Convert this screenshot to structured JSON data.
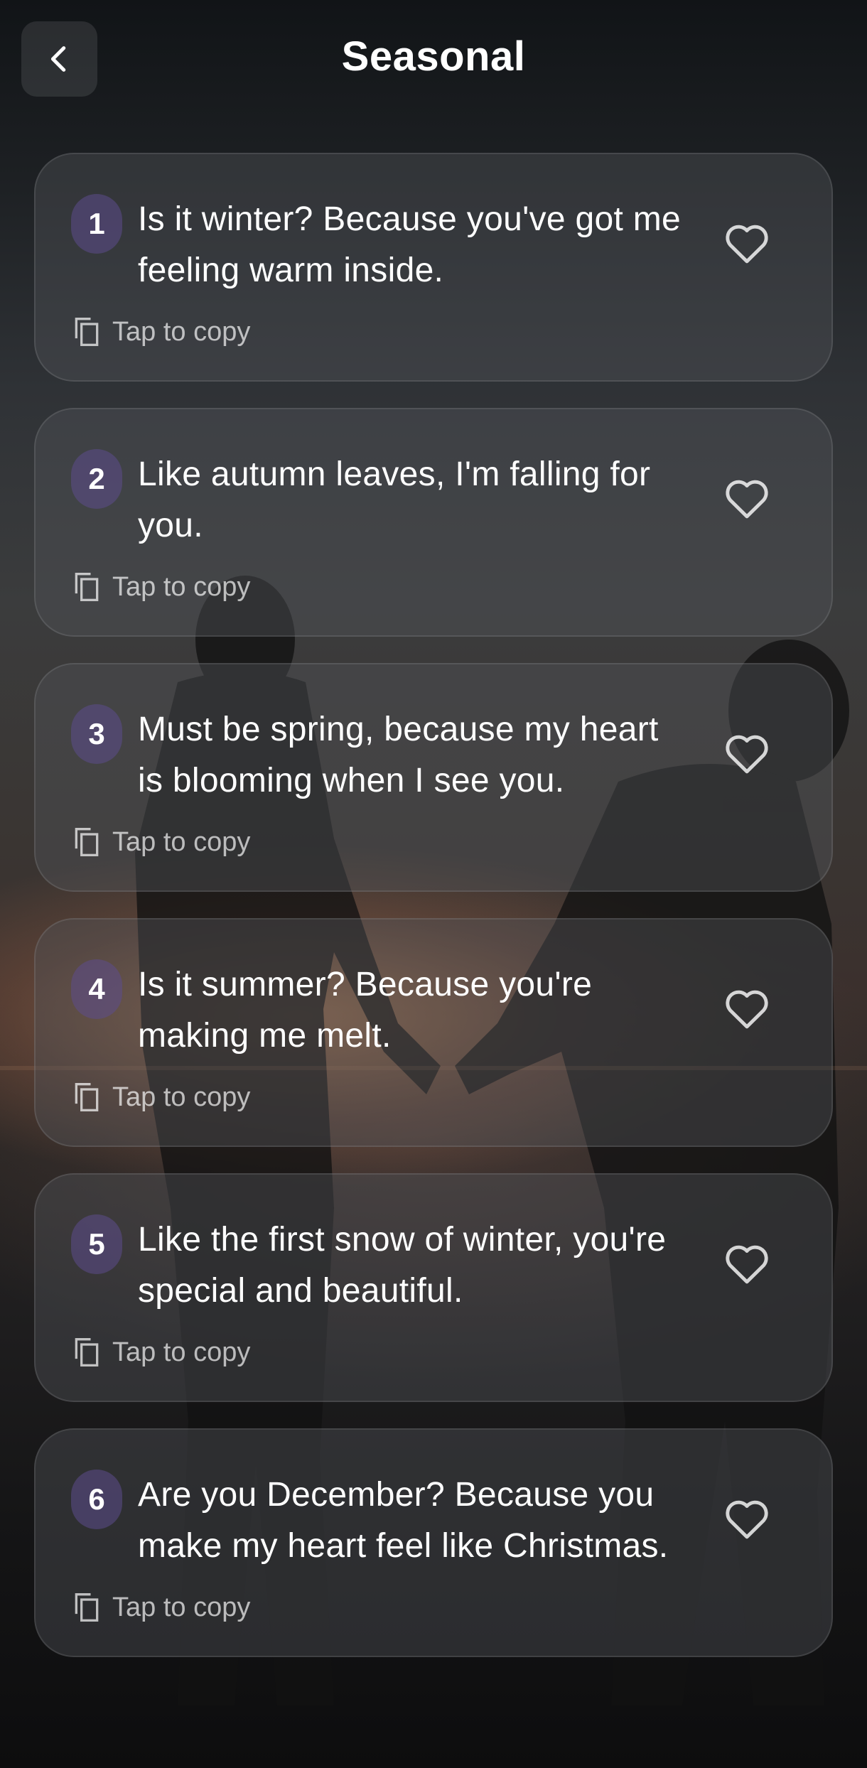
{
  "header": {
    "title": "Seasonal",
    "back_icon": "chevron-left-icon"
  },
  "copy_label": "Tap to copy",
  "quotes": [
    {
      "number": "1",
      "text": "Is it winter? Because you've got me feeling warm inside."
    },
    {
      "number": "2",
      "text": "Like autumn leaves, I'm falling for you."
    },
    {
      "number": "3",
      "text": "Must be spring, because my heart is blooming when I see you."
    },
    {
      "number": "4",
      "text": "Is it summer? Because you're making me melt."
    },
    {
      "number": "5",
      "text": "Like the first snow of winter, you're special and beautiful."
    },
    {
      "number": "6",
      "text": "Are you December? Because you make my heart feel like Christmas."
    }
  ],
  "colors": {
    "badge": "#5c4c8c",
    "card": "#505458",
    "text": "#ffffff",
    "muted": "#b4b4b4"
  }
}
